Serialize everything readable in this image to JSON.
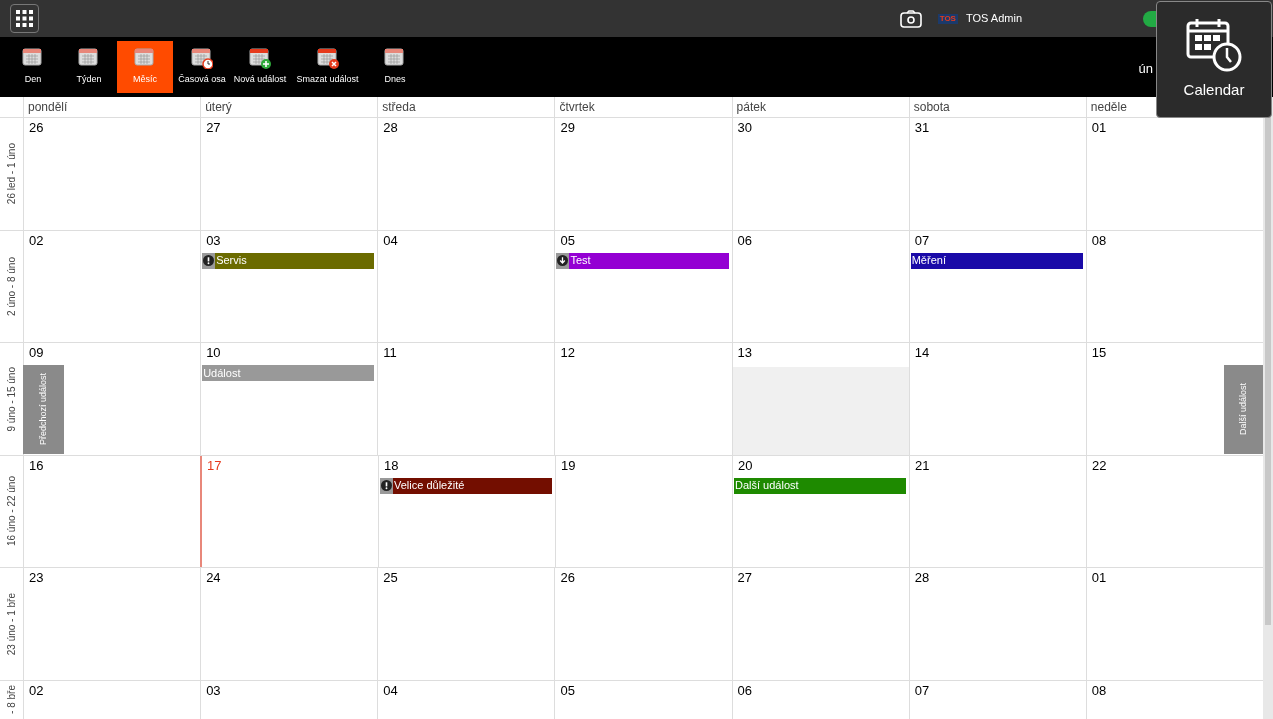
{
  "top_bar": {
    "logo": "TOS",
    "user": "TOS Admin",
    "toggle": {
      "on": true
    }
  },
  "toolbar": {
    "buttons": [
      {
        "label": "Den",
        "selected": false
      },
      {
        "label": "Týden",
        "selected": false
      },
      {
        "label": "Měsíc",
        "selected": true
      },
      {
        "label": "Časová osa",
        "selected": false
      },
      {
        "label": "Nová událost",
        "selected": false
      },
      {
        "label": "Smazat událost",
        "selected": false
      },
      {
        "label": "Dnes",
        "selected": false
      }
    ],
    "month_label": "ún"
  },
  "app_tile": {
    "label": "Calendar"
  },
  "weekdays": [
    "pondělí",
    "úterý",
    "středa",
    "čtvrtek",
    "pátek",
    "sobota",
    "neděle"
  ],
  "weeks": [
    {
      "label": "26 led - 1 úno",
      "days": [
        {
          "number": "26"
        },
        {
          "number": "27"
        },
        {
          "number": "28"
        },
        {
          "number": "29"
        },
        {
          "number": "30"
        },
        {
          "number": "31"
        },
        {
          "number": "01"
        }
      ]
    },
    {
      "label": "2 úno - 8 úno",
      "days": [
        {
          "number": "02"
        },
        {
          "number": "03",
          "events": [
            {
              "title": "Servis",
              "color": "#6b6b00",
              "kind": "important"
            }
          ]
        },
        {
          "number": "04"
        },
        {
          "number": "05",
          "events": [
            {
              "title": "Test",
              "color": "#9400d3",
              "kind": "download"
            }
          ]
        },
        {
          "number": "06"
        },
        {
          "number": "07",
          "events": [
            {
              "title": "Měření",
              "color": "#1a0aa8",
              "kind": "plain"
            }
          ]
        },
        {
          "number": "08"
        }
      ]
    },
    {
      "label": "9 úno - 15 úno",
      "days": [
        {
          "number": "09"
        },
        {
          "number": "10",
          "events": [
            {
              "title": "Událost",
              "color": "#999999",
              "kind": "plain"
            }
          ]
        },
        {
          "number": "11"
        },
        {
          "number": "12"
        },
        {
          "number": "13",
          "selected": true
        },
        {
          "number": "14"
        },
        {
          "number": "15"
        }
      ]
    },
    {
      "label": "16 úno - 22 úno",
      "days": [
        {
          "number": "16"
        },
        {
          "number": "17",
          "today": true
        },
        {
          "number": "18",
          "events": [
            {
              "title": "Velice důležité",
              "color": "#730e00",
              "kind": "important"
            }
          ]
        },
        {
          "number": "19"
        },
        {
          "number": "20",
          "events": [
            {
              "title": "Další událost",
              "color": "#1e8a00",
              "kind": "plain"
            }
          ]
        },
        {
          "number": "21"
        },
        {
          "number": "22"
        }
      ]
    },
    {
      "label": "23 úno - 1 bře",
      "days": [
        {
          "number": "23"
        },
        {
          "number": "24"
        },
        {
          "number": "25"
        },
        {
          "number": "26"
        },
        {
          "number": "27"
        },
        {
          "number": "28"
        },
        {
          "number": "01"
        }
      ]
    },
    {
      "label": "- 8 bře",
      "days": [
        {
          "number": "02"
        },
        {
          "number": "03"
        },
        {
          "number": "04"
        },
        {
          "number": "05"
        },
        {
          "number": "06"
        },
        {
          "number": "07"
        },
        {
          "number": "08"
        }
      ]
    }
  ],
  "prev_button": {
    "label": "Předchozí událost"
  },
  "next_button": {
    "label": "Další událost"
  }
}
